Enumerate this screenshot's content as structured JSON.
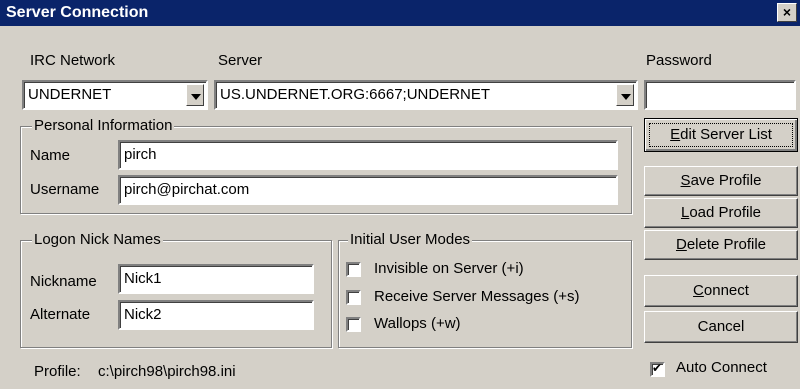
{
  "window": {
    "title": "Server Connection",
    "close_glyph": "×"
  },
  "labels": {
    "irc_network": "IRC Network",
    "server": "Server",
    "password": "Password"
  },
  "fields": {
    "irc_network_value": "UNDERNET",
    "server_value": "US.UNDERNET.ORG:6667;UNDERNET",
    "password_value": ""
  },
  "personal": {
    "title": "Personal Information",
    "name_label": "Name",
    "name_value": "pirch",
    "username_label": "Username",
    "username_value": "pirch@pirchat.com"
  },
  "logon": {
    "title": "Logon Nick Names",
    "nickname_label": "Nickname",
    "nickname_value": "Nick1",
    "alternate_label": "Alternate",
    "alternate_value": "Nick2"
  },
  "modes": {
    "title": "Initial User Modes",
    "items": [
      {
        "label": "Invisible on Server (+i)",
        "checked": false
      },
      {
        "label": "Receive Server Messages (+s)",
        "checked": false
      },
      {
        "label": "Wallops (+w)",
        "checked": false
      }
    ]
  },
  "buttons": {
    "edit_server_list": {
      "mnemonic": "E",
      "rest": "dit Server List"
    },
    "save_profile": {
      "mnemonic": "S",
      "rest": "ave Profile"
    },
    "load_profile": {
      "mnemonic": "L",
      "rest": "oad Profile"
    },
    "delete_profile": {
      "mnemonic": "D",
      "rest": "elete Profile"
    },
    "connect": {
      "mnemonic": "C",
      "rest": "onnect"
    },
    "cancel": "Cancel"
  },
  "footer": {
    "profile_label": "Profile:",
    "profile_path": "c:\\pirch98\\pirch98.ini",
    "auto_connect_label": "Auto Connect",
    "auto_connect_checked": true
  }
}
